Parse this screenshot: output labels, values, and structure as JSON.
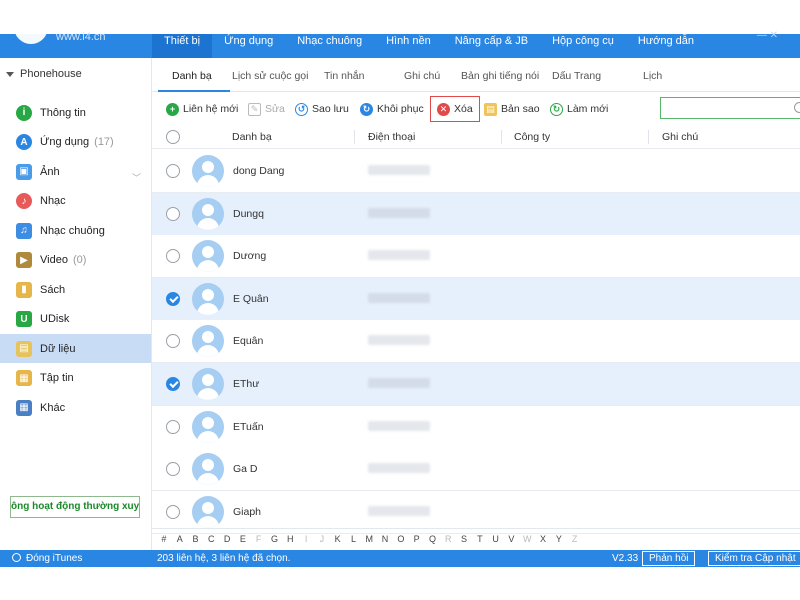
{
  "header": {
    "site": "www.i4.cn",
    "tabs": [
      {
        "label": "Thiết bị",
        "active": true
      },
      {
        "label": "Ứng dụng",
        "active": false
      },
      {
        "label": "Nhạc chuông",
        "active": false
      },
      {
        "label": "Hình nền",
        "active": false
      },
      {
        "label": "Nâng cấp & JB",
        "active": false
      },
      {
        "label": "Hộp công cụ",
        "active": false
      },
      {
        "label": "Hướng dẫn",
        "active": false
      }
    ]
  },
  "sidebar": {
    "device": "Phonehouse",
    "items": [
      {
        "label": "Thông tin",
        "count": "",
        "icon": "info-icon",
        "color": "#27a844"
      },
      {
        "label": "Ứng dụng",
        "count": "(17)",
        "icon": "app-store-icon",
        "color": "#2a86e3"
      },
      {
        "label": "Ảnh",
        "count": "",
        "icon": "photo-icon",
        "color": "#4a9be8"
      },
      {
        "label": "Nhạc",
        "count": "",
        "icon": "music-icon",
        "color": "#e8595a"
      },
      {
        "label": "Nhạc chuông",
        "count": "",
        "icon": "bell-icon",
        "color": "#3d8de3"
      },
      {
        "label": "Video",
        "count": "(0)",
        "icon": "video-icon",
        "color": "#b08a3c"
      },
      {
        "label": "Sách",
        "count": "",
        "icon": "book-icon",
        "color": "#e7b64a"
      },
      {
        "label": "UDisk",
        "count": "",
        "icon": "usb-icon",
        "color": "#27a844"
      },
      {
        "label": "Dữ liệu",
        "count": "",
        "icon": "data-icon",
        "color": "#e7c35c"
      },
      {
        "label": "Tập tin",
        "count": "",
        "icon": "file-icon",
        "color": "#e7b64a"
      },
      {
        "label": "Khác",
        "count": "",
        "icon": "grid-icon",
        "color": "#4a7fc4"
      }
    ],
    "active_index": 8,
    "marquee": "ông hoạt động thường xuyê"
  },
  "content_tabs": [
    {
      "label": "Danh bạ",
      "active": true
    },
    {
      "label": "Lịch sử cuộc gọi",
      "active": false
    },
    {
      "label": "Tin nhắn",
      "active": false
    },
    {
      "label": "Ghi chú",
      "active": false
    },
    {
      "label": "Bản ghi tiếng nói",
      "active": false
    },
    {
      "label": "Dấu Trang",
      "active": false
    },
    {
      "label": "Lịch",
      "active": false
    }
  ],
  "toolbar": {
    "new_contact": "Liên hệ mới",
    "edit": "Sửa",
    "backup": "Sao lưu",
    "restore": "Khôi phục",
    "delete": "Xóa",
    "copy": "Bản sao",
    "refresh": "Làm mới",
    "search_placeholder": ""
  },
  "table": {
    "columns": [
      "Danh bạ",
      "Điện thoại",
      "Công ty",
      "Ghi chú"
    ],
    "rows": [
      {
        "name": "dong Dang",
        "checked": false,
        "selected": false
      },
      {
        "name": "Dungq",
        "checked": false,
        "selected": true
      },
      {
        "name": "Dương",
        "checked": false,
        "selected": false
      },
      {
        "name": "E Quân",
        "checked": true,
        "selected": true
      },
      {
        "name": "Equân",
        "checked": false,
        "selected": false
      },
      {
        "name": "EThư",
        "checked": true,
        "selected": true
      },
      {
        "name": "ETuấn",
        "checked": false,
        "selected": false
      },
      {
        "name": "Ga D",
        "checked": false,
        "selected": false
      },
      {
        "name": "Giaph",
        "checked": false,
        "selected": false
      }
    ]
  },
  "alphabet": [
    {
      "ch": "#",
      "on": true
    },
    {
      "ch": "A",
      "on": true
    },
    {
      "ch": "B",
      "on": true
    },
    {
      "ch": "C",
      "on": true
    },
    {
      "ch": "D",
      "on": true
    },
    {
      "ch": "E",
      "on": true
    },
    {
      "ch": "F",
      "on": false
    },
    {
      "ch": "G",
      "on": true
    },
    {
      "ch": "H",
      "on": true
    },
    {
      "ch": "I",
      "on": false
    },
    {
      "ch": "J",
      "on": false
    },
    {
      "ch": "K",
      "on": true
    },
    {
      "ch": "L",
      "on": true
    },
    {
      "ch": "M",
      "on": true
    },
    {
      "ch": "N",
      "on": true
    },
    {
      "ch": "O",
      "on": true
    },
    {
      "ch": "P",
      "on": true
    },
    {
      "ch": "Q",
      "on": true
    },
    {
      "ch": "R",
      "on": false
    },
    {
      "ch": "S",
      "on": true
    },
    {
      "ch": "T",
      "on": true
    },
    {
      "ch": "U",
      "on": true
    },
    {
      "ch": "V",
      "on": true
    },
    {
      "ch": "W",
      "on": false
    },
    {
      "ch": "X",
      "on": true
    },
    {
      "ch": "Y",
      "on": true
    },
    {
      "ch": "Z",
      "on": false
    }
  ],
  "status": {
    "itunes": "Đóng iTunes",
    "text": "203 liên hệ, 3 liên hệ đã chọn.",
    "version": "V2.33",
    "feedback": "Phản hồi",
    "check_update": "Kiểm tra Cập nhật"
  },
  "colors": {
    "accent": "#2a86e3",
    "selected_row": "#e6f0fc",
    "sidebar_active": "#c9dcf6",
    "delete_border": "#e04a4a"
  }
}
